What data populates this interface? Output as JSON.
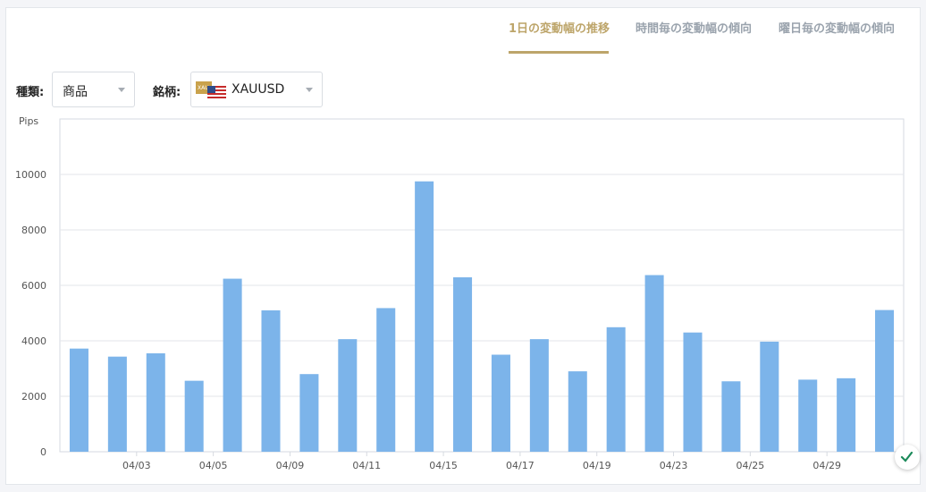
{
  "tabs": [
    {
      "label": "1日の変動幅の推移",
      "active": true
    },
    {
      "label": "時間毎の変動幅の傾向",
      "active": false
    },
    {
      "label": "曜日毎の変動幅の傾向",
      "active": false
    }
  ],
  "filters": {
    "type_label": "種類:",
    "type_value": "商品",
    "symbol_label": "銘柄:",
    "symbol_value": "XAUUSD",
    "symbol_flag_text": "XAU"
  },
  "colors": {
    "accent": "#bda56a",
    "bar": "#7cb4ea",
    "tab_inactive": "#9aa3ad",
    "grid": "#e3e6ea"
  },
  "chart_data": {
    "type": "bar",
    "ylabel": "Pips",
    "ylim": [
      0,
      12000
    ],
    "yticks": [
      0,
      2000,
      4000,
      6000,
      8000,
      10000
    ],
    "grid": true,
    "xtick_labels": [
      "04/03",
      "04/05",
      "04/09",
      "04/11",
      "04/15",
      "04/17",
      "04/19",
      "04/23",
      "04/25",
      "04/29"
    ],
    "xtick_after_bar": [
      1,
      3,
      5,
      7,
      9,
      11,
      13,
      15,
      17,
      19
    ],
    "values": [
      3720,
      3430,
      3550,
      2560,
      6240,
      5100,
      2800,
      4060,
      5180,
      9750,
      6290,
      3500,
      4060,
      2900,
      4490,
      6370,
      4300,
      2540,
      3970,
      2600,
      2650,
      5110
    ]
  }
}
